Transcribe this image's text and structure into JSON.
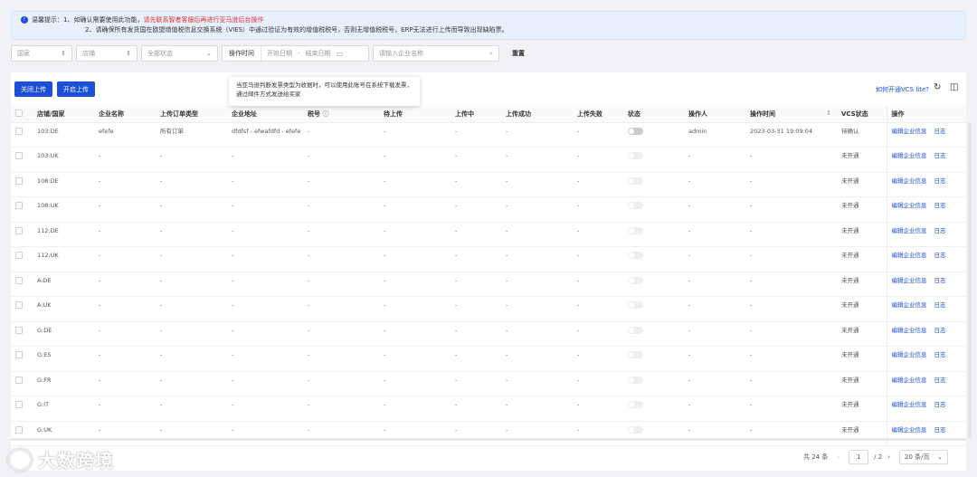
{
  "notice": {
    "prefix": "温馨提示：",
    "line1_a": "1、如确认需要使用此功能，",
    "line1_red": "请先联系智者客服后再进行亚马逊后台操作",
    "line2": "2、请确保所有发货国在欧盟增值税信息交换系统（VIES）中通过验证为有效的增值税税号，否则无增值税税号，ERP无法进行上传而导致出现缺陷票。"
  },
  "filters": {
    "country": "国家",
    "shop": "店铺",
    "status": "全部状态",
    "time_label": "操作时间",
    "start_date": "开始日期",
    "date_sep": "-",
    "end_date": "结束日期",
    "search_placeholder": "请输入企业名称",
    "reset": "重置"
  },
  "toolbar": {
    "close_upload": "关闭上传",
    "open_upload": "开启上传",
    "vcs_link": "如何开通VCS lite?",
    "tooltip": "当亚马逊判断发票类型为收据时，可以使用此账号在系统下载发票，通过邮件方式发送给买家"
  },
  "table": {
    "headers": [
      "店铺/国家",
      "企业名称",
      "上传订单类型",
      "企业地址",
      "税号",
      "待上传",
      "上传中",
      "上传成功",
      "上传失败",
      "状态",
      "操作人",
      "操作时间",
      "VCS状态",
      "操作"
    ],
    "action_edit": "编辑企业信息",
    "action_log": "日志",
    "rows": [
      {
        "shop": "103:DE",
        "company": "efefe",
        "type": "所有订单",
        "address": "dfdfsf - efwafdfd - efefe",
        "tax": "-",
        "pending": "-",
        "uploading": "-",
        "success": "-",
        "failed": "-",
        "toggle": "on",
        "operator": "admin",
        "time": "2023-03-31 19:09:04",
        "vcs": "待确认"
      },
      {
        "shop": "103:UK",
        "company": "-",
        "type": "-",
        "address": "-",
        "tax": "-",
        "pending": "-",
        "uploading": "-",
        "success": "-",
        "failed": "-",
        "toggle": "dis",
        "operator": "-",
        "time": "-",
        "vcs": "未开通"
      },
      {
        "shop": "108:DE",
        "company": "-",
        "type": "-",
        "address": "-",
        "tax": "-",
        "pending": "-",
        "uploading": "-",
        "success": "-",
        "failed": "-",
        "toggle": "dis",
        "operator": "-",
        "time": "-",
        "vcs": "未开通"
      },
      {
        "shop": "108:UK",
        "company": "-",
        "type": "-",
        "address": "-",
        "tax": "-",
        "pending": "-",
        "uploading": "-",
        "success": "-",
        "failed": "-",
        "toggle": "dis",
        "operator": "-",
        "time": "-",
        "vcs": "未开通"
      },
      {
        "shop": "112:DE",
        "company": "-",
        "type": "-",
        "address": "-",
        "tax": "-",
        "pending": "-",
        "uploading": "-",
        "success": "-",
        "failed": "-",
        "toggle": "dis",
        "operator": "-",
        "time": "-",
        "vcs": "未开通"
      },
      {
        "shop": "112:UK",
        "company": "-",
        "type": "-",
        "address": "-",
        "tax": "-",
        "pending": "-",
        "uploading": "-",
        "success": "-",
        "failed": "-",
        "toggle": "dis",
        "operator": "-",
        "time": "-",
        "vcs": "未开通"
      },
      {
        "shop": "A:DE",
        "company": "-",
        "type": "-",
        "address": "-",
        "tax": "-",
        "pending": "-",
        "uploading": "-",
        "success": "-",
        "failed": "-",
        "toggle": "dis",
        "operator": "-",
        "time": "-",
        "vcs": "未开通"
      },
      {
        "shop": "A:UK",
        "company": "-",
        "type": "-",
        "address": "-",
        "tax": "-",
        "pending": "-",
        "uploading": "-",
        "success": "-",
        "failed": "-",
        "toggle": "dis",
        "operator": "-",
        "time": "-",
        "vcs": "未开通"
      },
      {
        "shop": "G:DE",
        "company": "-",
        "type": "-",
        "address": "-",
        "tax": "-",
        "pending": "-",
        "uploading": "-",
        "success": "-",
        "failed": "-",
        "toggle": "dis",
        "operator": "-",
        "time": "-",
        "vcs": "未开通"
      },
      {
        "shop": "G:ES",
        "company": "-",
        "type": "-",
        "address": "-",
        "tax": "-",
        "pending": "-",
        "uploading": "-",
        "success": "-",
        "failed": "-",
        "toggle": "dis",
        "operator": "-",
        "time": "-",
        "vcs": "未开通"
      },
      {
        "shop": "G:FR",
        "company": "-",
        "type": "-",
        "address": "-",
        "tax": "-",
        "pending": "-",
        "uploading": "-",
        "success": "-",
        "failed": "-",
        "toggle": "dis",
        "operator": "-",
        "time": "-",
        "vcs": "未开通"
      },
      {
        "shop": "G:IT",
        "company": "-",
        "type": "-",
        "address": "-",
        "tax": "-",
        "pending": "-",
        "uploading": "-",
        "success": "-",
        "failed": "-",
        "toggle": "dis",
        "operator": "-",
        "time": "-",
        "vcs": "未开通"
      },
      {
        "shop": "G:UK",
        "company": "-",
        "type": "-",
        "address": "-",
        "tax": "-",
        "pending": "-",
        "uploading": "-",
        "success": "-",
        "failed": "-",
        "toggle": "dis",
        "operator": "-",
        "time": "-",
        "vcs": "未开通"
      }
    ]
  },
  "pagination": {
    "total": "共 24 条",
    "current": "1",
    "total_pages": "/ 2",
    "page_size": "20 条/页"
  },
  "watermark": "大数跨境"
}
